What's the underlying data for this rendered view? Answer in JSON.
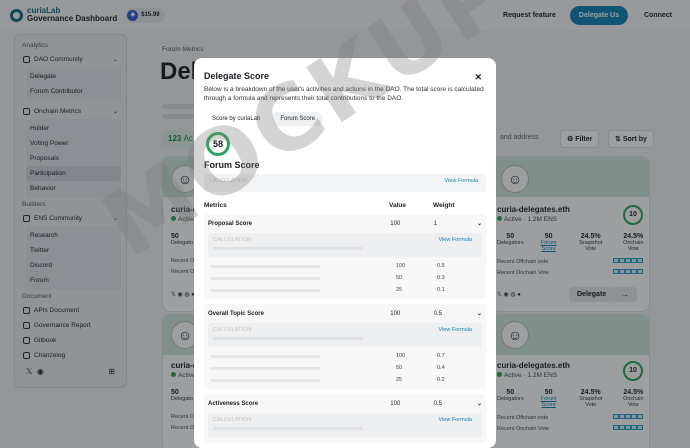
{
  "topbar": {
    "brand_line1": "curiaLab",
    "brand_line2": "Governance Dashboard",
    "price": "$15.99",
    "request_feature": "Request feature",
    "delegate_us": "Delegate Us",
    "connect": "Connect"
  },
  "sidebar": {
    "analytics": "Analytics",
    "dao_community": "DAO Community",
    "dao_items": [
      "Delegate",
      "Forum Contributor"
    ],
    "onchain_metrics": "Onchain Metrics",
    "onchain_items": [
      "Holder",
      "Voting Power",
      "Proposals",
      "Participation",
      "Behavior"
    ],
    "builders": "Builders",
    "ens_community": "ENS Community",
    "ens_items": [
      "Research",
      "Twitter",
      "Discord",
      "Forum"
    ],
    "document": "Document",
    "doc_items": [
      "APIs Document",
      "Governance Report",
      "Gitbook",
      "Chanzelog"
    ]
  },
  "main": {
    "breadcrumb": "Forum Metrics",
    "title": "Dele",
    "count": "123",
    "count_suffix": "Ac",
    "search_placeholder": "and address",
    "filter": "Filter",
    "sort": "Sort by"
  },
  "cards": [
    {
      "name": "curia-d",
      "status": "Active",
      "stat_value": "50",
      "stat_label": "Delegato",
      "row1": "Recent O",
      "row2": "Recent O"
    },
    {
      "name": "curia-delegates.eth",
      "status": "Active",
      "ens": "1.2M ENS",
      "score": "10",
      "stats": [
        {
          "v": "50",
          "k": "Delegators"
        },
        {
          "v": "50",
          "k": "Forum Score"
        },
        {
          "v": "24.5%",
          "k": "Snapshot Vote"
        },
        {
          "v": "24.5%",
          "k": "Onchain Vote"
        }
      ],
      "row1": "Recent Offchain vote",
      "row2": "Recent Onchain Vote",
      "delegate": "Delegate",
      "arrow": "→"
    },
    {
      "name": "curia-d",
      "status": "Active",
      "stat_value": "50",
      "stat_label": "Delegato",
      "row1": "Recent O",
      "row2": "Recent O"
    },
    {
      "name": "curia-delegates.eth",
      "status": "Active",
      "ens": "1.2M ENS",
      "score": "10",
      "stats": [
        {
          "v": "50",
          "k": "Delegators"
        },
        {
          "v": "50",
          "k": "Forum Score"
        },
        {
          "v": "24.5%",
          "k": "Snapshot Vote"
        },
        {
          "v": "24.5%",
          "k": "Onchain Vote"
        }
      ],
      "row1": "Recent Offchain vote",
      "row2": "Recent Onchain Vote"
    }
  ],
  "modal": {
    "title": "Delegate Score",
    "close": "✕",
    "description": "Below is a breakdown of the user's activities and actions in the DAO. The total score is calculated through a formula and represents their total contributions to the DAO.",
    "tab1": "Score by curiaLab",
    "tab2": "Forum Score",
    "score": "58",
    "score_label": "Forum Score",
    "calc_label": "CALCULATION",
    "view_formula": "View Formula",
    "col_metrics": "Metrics",
    "col_value": "Value",
    "col_weight": "Weight",
    "sections": [
      {
        "name": "Proposal Score",
        "value": "100",
        "weight": "1",
        "rows": [
          [
            "100",
            "0.5"
          ],
          [
            "50",
            "0.3"
          ],
          [
            "25",
            "0.1"
          ]
        ]
      },
      {
        "name": "Overall Topic Score",
        "value": "100",
        "weight": "0.5",
        "rows": [
          [
            "100",
            "0.7"
          ],
          [
            "50",
            "0.4"
          ],
          [
            "25",
            "0.2"
          ]
        ]
      },
      {
        "name": "Activeness Score",
        "value": "100",
        "weight": "0.5",
        "rows": []
      }
    ]
  },
  "watermark": "MOCKUP"
}
